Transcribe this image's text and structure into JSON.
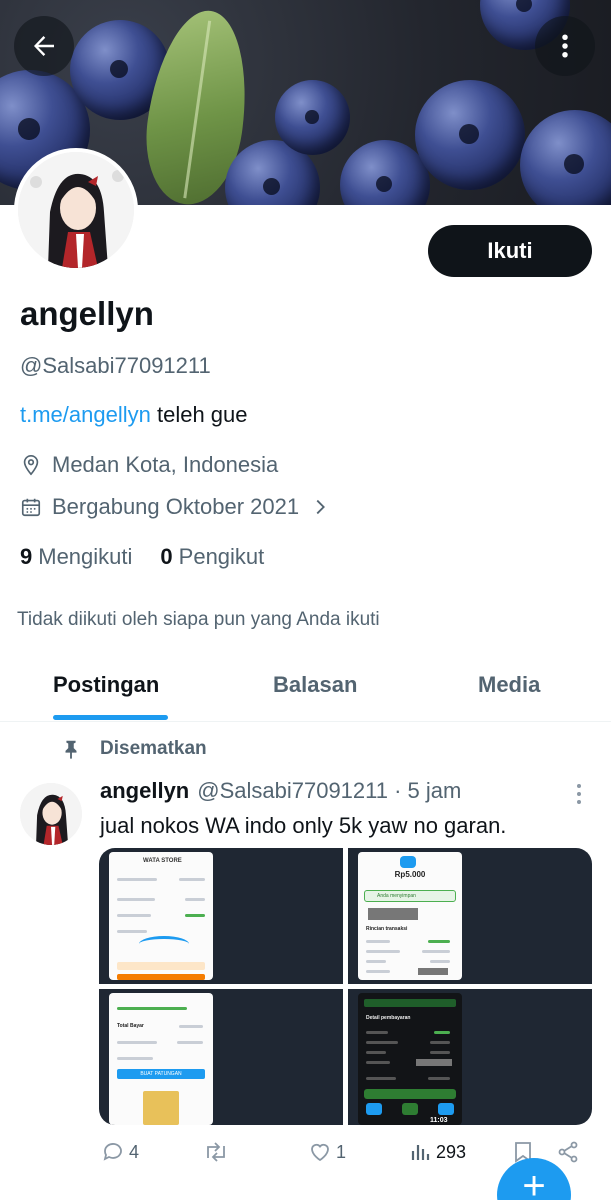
{
  "profile": {
    "follow_label": "Ikuti",
    "name": "angellyn",
    "handle": "@Salsabi77091211",
    "bio_link": "t.me/angellyn",
    "bio_text": " teleh gue",
    "location": "Medan Kota, Indonesia",
    "joined": "Bergabung Oktober 2021",
    "following_count": "9",
    "following_label": "Mengikuti",
    "followers_count": "0",
    "followers_label": "Pengikut",
    "not_followed_note": "Tidak diikuti oleh siapa pun yang Anda ikuti"
  },
  "tabs": [
    {
      "label": "Postingan",
      "active": true
    },
    {
      "label": "Balasan",
      "active": false
    },
    {
      "label": "Media",
      "active": false
    }
  ],
  "post": {
    "pinned_label": "Disematkan",
    "author": "angellyn",
    "handle_time": "@Salsabi77091211 · 5 jam",
    "text": "jual nokos WA indo only 5k yaw no garan.",
    "media_texts": {
      "store": "WATA STORE",
      "amount": "Rp5.000",
      "paid": "Anda menyimpan",
      "details": "Rincian transaksi",
      "total": "Total Bayar",
      "pay_button": "BUAT PATUNGAN",
      "payment_details": "Detail pembayaran",
      "time": "11:03"
    },
    "replies": "4",
    "reposts": "",
    "likes": "1",
    "views": "293"
  },
  "icons": {
    "back": "arrow-left-icon",
    "more": "more-vertical-icon",
    "location": "location-pin-icon",
    "calendar": "calendar-icon",
    "chevron": "chevron-right-icon",
    "pin": "pin-icon",
    "reply": "reply-icon",
    "repost": "repost-icon",
    "like": "heart-icon",
    "views": "views-icon",
    "bookmark": "bookmark-icon",
    "share": "share-icon",
    "compose": "plus-icon"
  },
  "colors": {
    "accent": "#1d9bf0",
    "text": "#0f1419",
    "muted": "#536471"
  }
}
